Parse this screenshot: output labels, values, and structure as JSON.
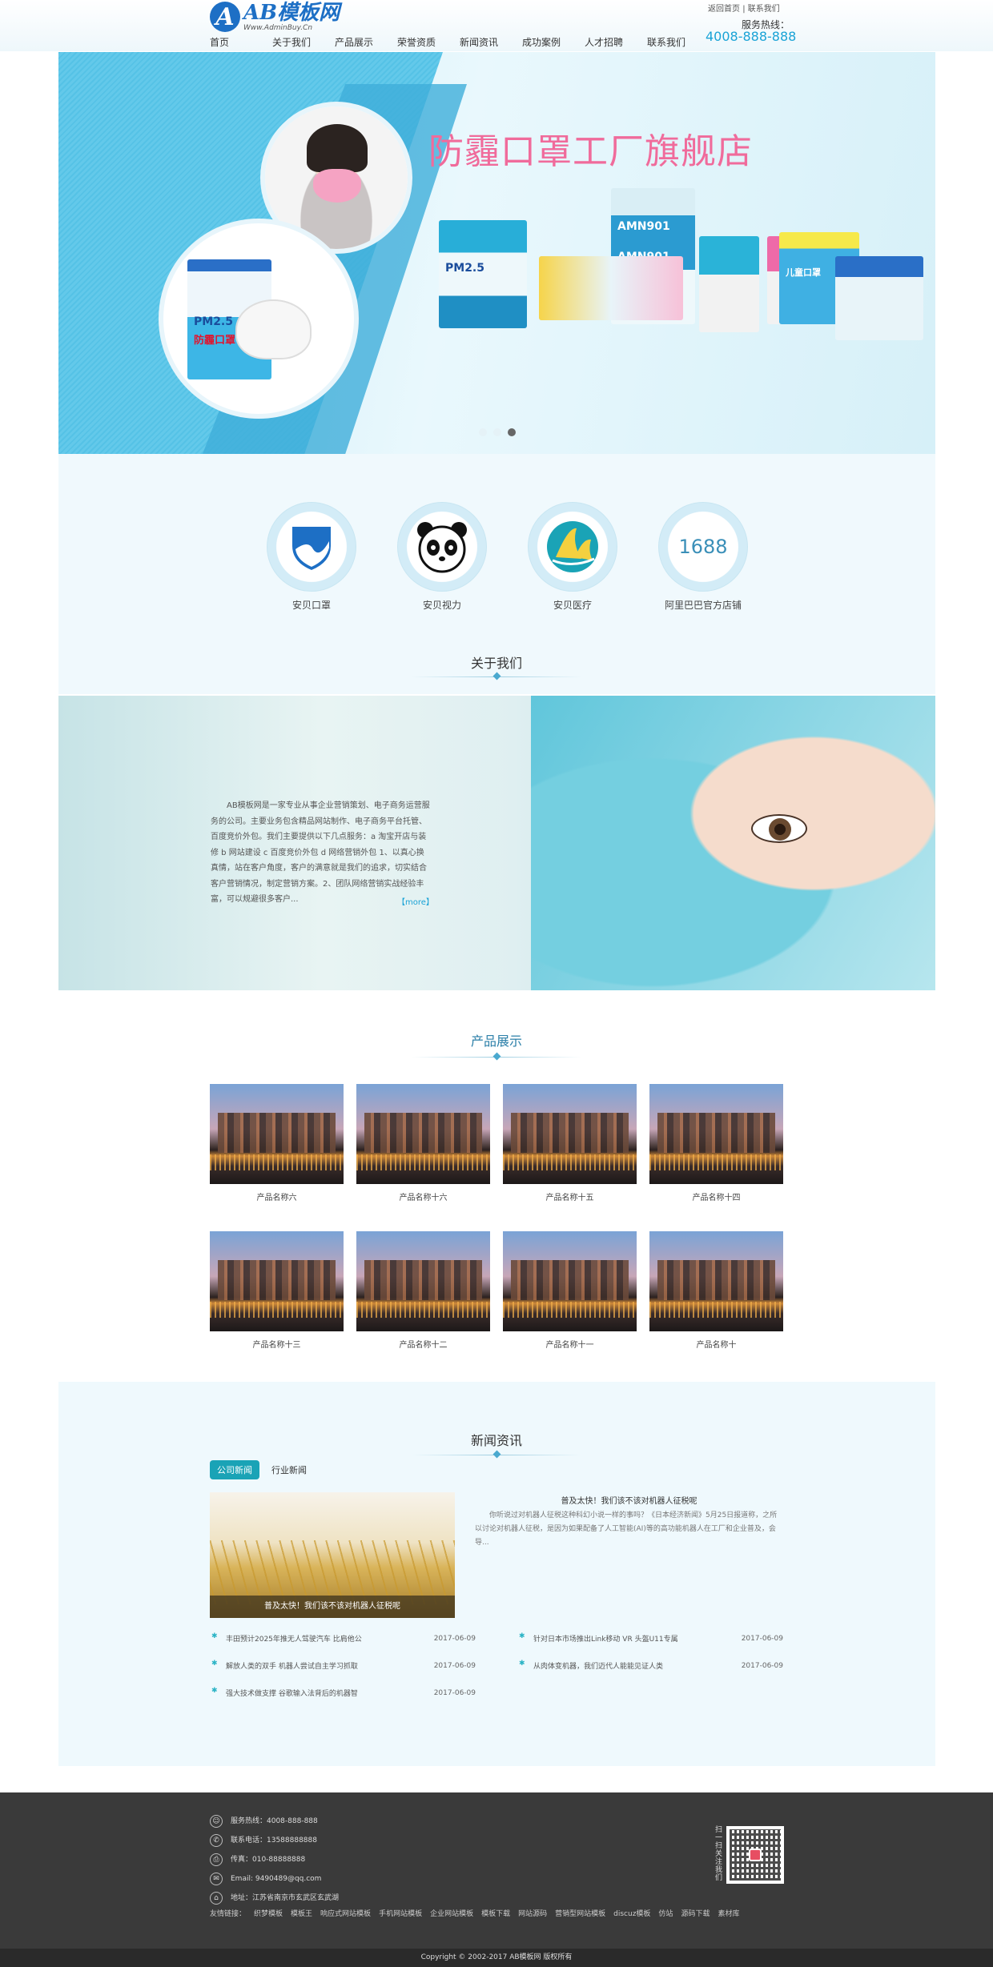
{
  "header": {
    "logo_mark": "A",
    "logo_title": "AB模板网",
    "logo_url": "Www.AdminBuy.Cn",
    "top_links": [
      "返回首页",
      "联系我们"
    ],
    "top_sep": "|",
    "hotline_label": "服务热线：",
    "hotline": "4008-888-888",
    "nav": [
      "首页",
      "关于我们",
      "产品展示",
      "荣誉资质",
      "新闻资讯",
      "成功案例",
      "人才招聘",
      "联系我们"
    ]
  },
  "banner": {
    "title": "防霾口罩工厂旗舰店",
    "pack_label_pm": "PM2.5",
    "pack_label_mask": "防霾口罩",
    "pack_label_amn": "AMN901",
    "pack_label_kids": "儿童口罩",
    "slides": 3,
    "active_slide": 2
  },
  "features": [
    {
      "label": "安贝口罩",
      "icon": "shield-icon"
    },
    {
      "label": "安贝视力",
      "icon": "panda-icon"
    },
    {
      "label": "安贝医疗",
      "icon": "sail-icon"
    },
    {
      "label": "阿里巴巴官方店铺",
      "icon": "number-badge-icon",
      "number": "1688"
    }
  ],
  "about": {
    "title": "关于我们",
    "text": "AB模板网是一家专业从事企业营销策划、电子商务运营服务的公司。主要业务包含精品网站制作、电子商务平台托管、百度竞价外包。我们主要提供以下几点服务：a 淘宝开店与装修 b 网站建设 c 百度竞价外包 d 网络营销外包 1、以真心换真情，站在客户角度，客户的满意就是我们的追求，切实结合客户营销情况，制定营销方案。2、团队网络营销实战经验丰富，可以规避很多客户...",
    "more": "【more】"
  },
  "products": {
    "title": "产品展示",
    "items": [
      "产品名称六",
      "产品名称十六",
      "产品名称十五",
      "产品名称十四",
      "产品名称十三",
      "产品名称十二",
      "产品名称十一",
      "产品名称十"
    ]
  },
  "news": {
    "title": "新闻资讯",
    "tabs": [
      "公司新闻",
      "行业新闻"
    ],
    "active_tab": 0,
    "featured_caption": "普及太快！我们该不该对机器人征税呢",
    "headline": "普及太快！我们该不该对机器人征税呢",
    "summary": "你听说过对机器人征税这种科幻小说一样的事吗？《日本经济新闻》5月25日报道称，之所以讨论对机器人征税，是因为如果配备了人工智能(AI)等的高功能机器人在工厂和企业普及，会导...",
    "items": [
      {
        "title": "丰田预计2025年推无人驾驶汽车 比肩他公",
        "date": "2017-06-09"
      },
      {
        "title": "针对日本市场推出Link移动 VR 头盔U11专属",
        "date": "2017-06-09"
      },
      {
        "title": "解放人类的双手 机器人尝试自主学习抓取",
        "date": "2017-06-09"
      },
      {
        "title": "从肉体变机器，我们迈代人能能见证人类",
        "date": "2017-06-09"
      },
      {
        "title": "强大技术做支撑 谷歌输入法背后的机器智",
        "date": "2017-06-09"
      }
    ]
  },
  "footer": {
    "info": [
      {
        "icon": "service-user-icon",
        "text": "服务热线：4008-888-888"
      },
      {
        "icon": "phone-icon",
        "text": "联系电话：13588888888"
      },
      {
        "icon": "fax-icon",
        "text": "传真：010-88888888"
      },
      {
        "icon": "mail-icon",
        "text": "Email: 9490489@qq.com"
      },
      {
        "icon": "address-icon",
        "text": "地址：江苏省南京市玄武区玄武湖"
      }
    ],
    "links_label": "友情链接：",
    "links": [
      "织梦模板",
      "模板王",
      "响应式网站模板",
      "手机网站模板",
      "企业网站模板",
      "模板下载",
      "网站源码",
      "营销型网站模板",
      "discuz模板",
      "仿站",
      "源码下载",
      "素材库"
    ],
    "qr_caption": "扫一扫关注我们",
    "copyright": "Copyright © 2002-2017 AB模板网 版权所有"
  }
}
